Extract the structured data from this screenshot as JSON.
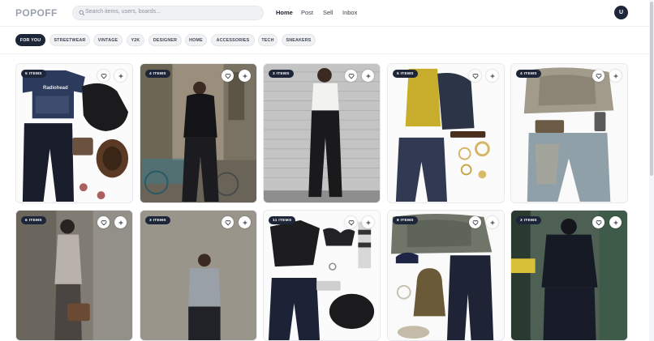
{
  "app": {
    "logo": "POPOFF"
  },
  "search": {
    "placeholder": "Search items, users, boards..."
  },
  "nav": {
    "home": "Home",
    "post": "Post",
    "sell": "Sell",
    "inbox": "Inbox"
  },
  "user": {
    "initial": "U"
  },
  "chips": [
    "FOR YOU",
    "STREETWEAR",
    "VINTAGE",
    "Y2K",
    "DESIGNER",
    "HOME",
    "ACCESSORIES",
    "TECH",
    "SNEAKERS"
  ],
  "cards": [
    {
      "badge": "5 ITEMS",
      "tshirt_text": "Radiohead",
      "liked": false
    },
    {
      "badge": "4 ITEMS",
      "liked": false
    },
    {
      "badge": "3 ITEMS",
      "liked": false
    },
    {
      "badge": "5 ITEMS",
      "liked": false
    },
    {
      "badge": "4 ITEMS",
      "liked": false
    },
    {
      "badge": "6 ITEMS",
      "liked": false
    },
    {
      "badge": "3 ITEMS",
      "liked": false
    },
    {
      "badge": "11 ITEMS",
      "liked": false
    },
    {
      "badge": "8 ITEMS",
      "liked": false
    },
    {
      "badge": "3 ITEMS",
      "liked": false
    }
  ],
  "colors": {
    "accent": "#1d2538",
    "chip_bg": "#f1f2f4"
  },
  "icons": {
    "search": "search-icon",
    "like": "heart-icon",
    "save": "plus-icon"
  }
}
